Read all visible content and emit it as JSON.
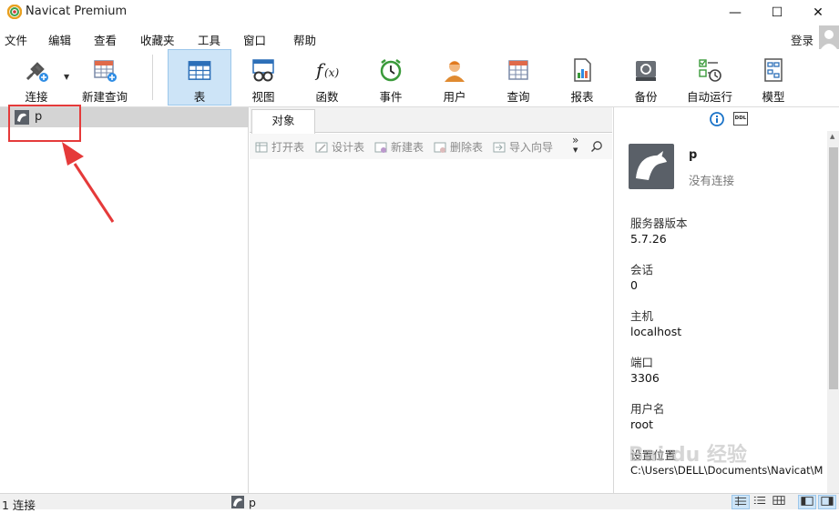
{
  "app": {
    "title": "Navicat Premium"
  },
  "window_controls": {
    "minimize": "—",
    "maximize": "☐",
    "close": "✕"
  },
  "menu": [
    "文件",
    "编辑",
    "查看",
    "收藏夹",
    "工具",
    "窗口",
    "帮助"
  ],
  "login_label": "登录",
  "toolbar": {
    "connect": "连接",
    "new_query": "新建查询",
    "table": "表",
    "view": "视图",
    "function": "函数",
    "event": "事件",
    "user": "用户",
    "query": "查询",
    "report": "报表",
    "backup": "备份",
    "automation": "自动运行",
    "model": "模型"
  },
  "nav": {
    "connection": "p"
  },
  "object_pane": {
    "tab": "对象",
    "actions": {
      "open": "打开表",
      "design": "设计表",
      "new": "新建表",
      "delete": "删除表",
      "import": "导入向导"
    },
    "more": "»"
  },
  "info": {
    "name": "p",
    "status": "没有连接",
    "ddl_label": "DDL",
    "fields": [
      {
        "label": "服务器版本",
        "value": "5.7.26"
      },
      {
        "label": "会话",
        "value": "0"
      },
      {
        "label": "主机",
        "value": "localhost"
      },
      {
        "label": "端口",
        "value": "3306"
      },
      {
        "label": "用户名",
        "value": "root"
      },
      {
        "label": "设置位置",
        "value": "C:\\Users\\DELL\\Documents\\Navicat\\M"
      }
    ]
  },
  "status": {
    "left": "1 连接",
    "connection": "p"
  },
  "watermark": "Bai du 经验",
  "colors": {
    "annotation": "#e53a3a",
    "active_tool": "#cde4f7"
  }
}
